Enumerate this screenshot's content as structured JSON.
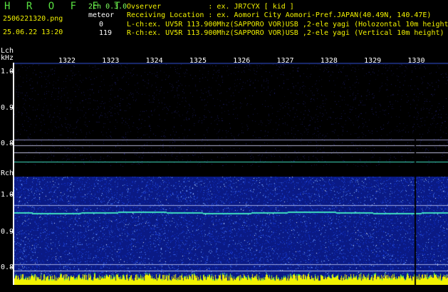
{
  "header": {
    "logo": "H R O F F T",
    "mode": "2ch 0.3.0",
    "filename": "2506221320.png",
    "datetime": "25.06.22 13:20",
    "meteor_label": "meteor",
    "meteor_l_count": "0",
    "meteor_r_count": "119",
    "observer": "Ovserver           : ex. JR7CYX [ kid ]",
    "location": "Receiving Location : ex. Aomori City Aomori-Pref.JAPAN(40.49N, 140.47E)",
    "lch_info": "L-ch:ex. UV5R 113.900Mhz(SAPPORO VOR)USB ,2-ele yagi (Holozontal 10m height",
    "rch_info": "R-ch:ex. UV5R 113.900Mhz(SAPPORO VOR)USB ,2-ele yagi (Vertical 10m height)"
  },
  "axis": {
    "lch_label": "Lch",
    "khz_label": "kHz",
    "rch_label": "Rch",
    "time_ticks": [
      "1322",
      "1323",
      "1324",
      "1325",
      "1326",
      "1327",
      "1328",
      "1329",
      "1330"
    ],
    "lch_ticks": [
      "1.0",
      "0.9",
      "0.8"
    ],
    "rch_ticks": [
      "1.0",
      "0.9",
      "0.8"
    ]
  },
  "colors": {
    "background": "#000000",
    "text_green": "#7CFC5A",
    "text_white": "#FFFFFF",
    "waterfall_bg": "#0a1a85",
    "carrier_line": "#40E0C0",
    "noise_yellow": "#F2F200"
  }
}
